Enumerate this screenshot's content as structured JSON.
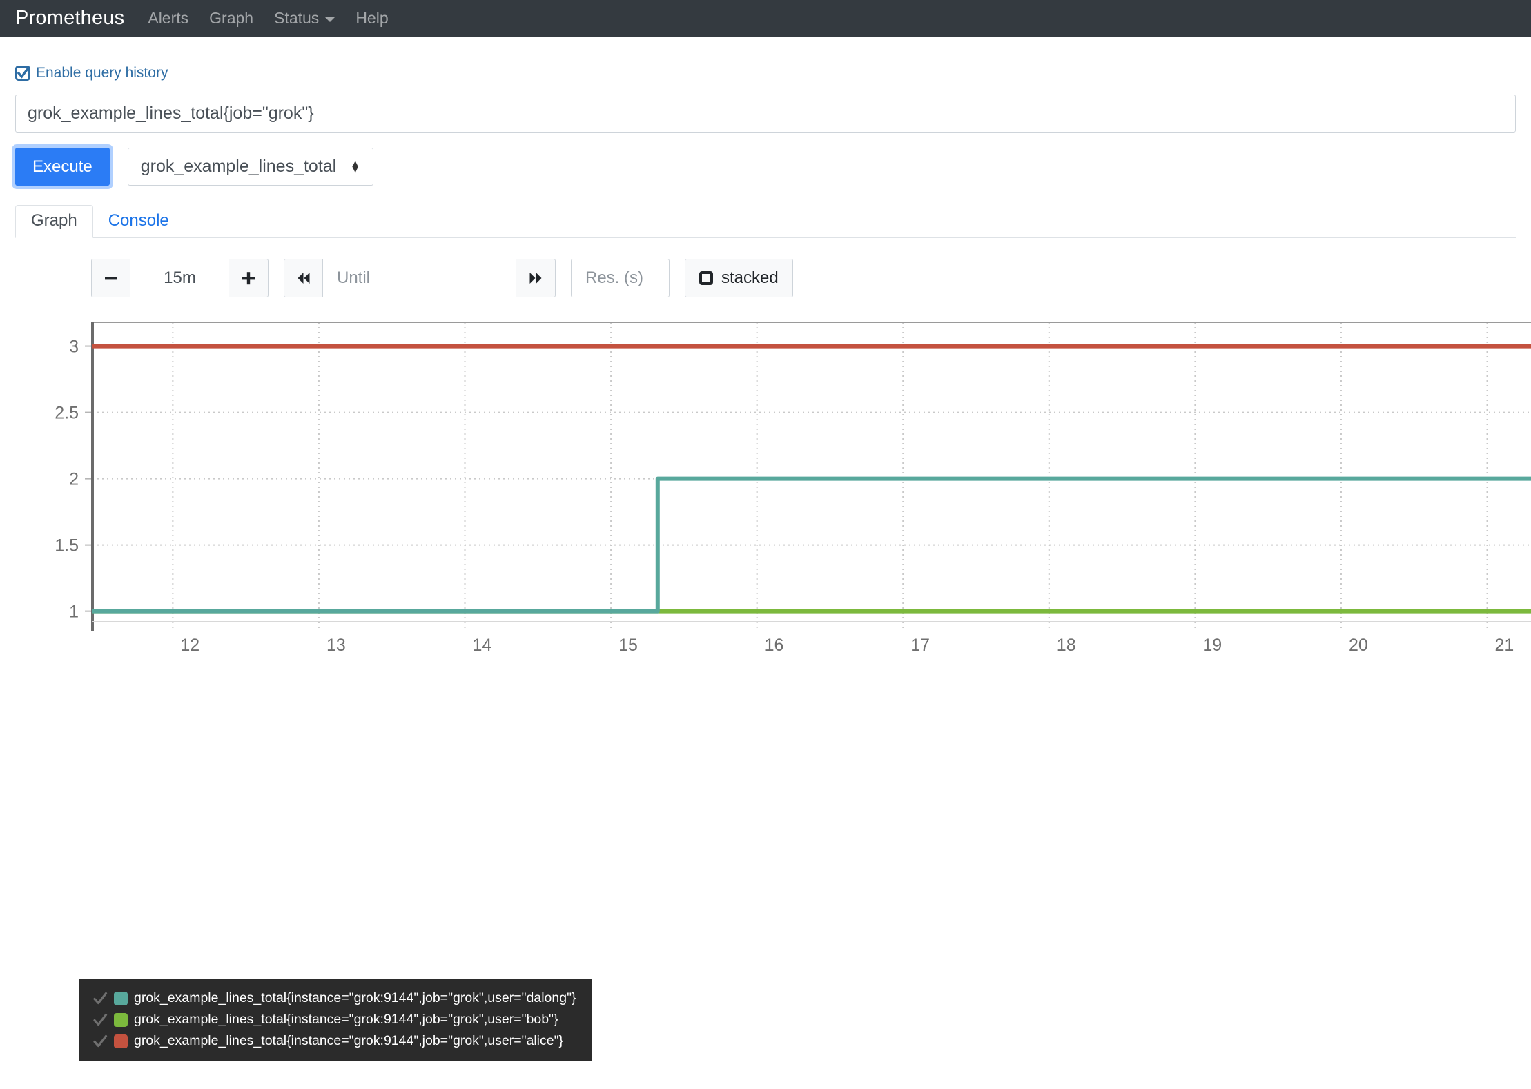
{
  "navbar": {
    "brand": "Prometheus",
    "links": [
      {
        "label": "Alerts",
        "icon": null
      },
      {
        "label": "Graph",
        "icon": null
      },
      {
        "label": "Status",
        "icon": "chevron-down-icon"
      },
      {
        "label": "Help",
        "icon": null
      }
    ]
  },
  "query": {
    "history_label": "Enable query history",
    "history_checked": true,
    "expression": "grok_example_lines_total{job=\"grok\"}",
    "execute_label": "Execute",
    "metric_selected": "grok_example_lines_total"
  },
  "tabs": [
    {
      "label": "Graph",
      "active": true
    },
    {
      "label": "Console",
      "active": false
    }
  ],
  "graph_controls": {
    "decrease_label": "−",
    "increase_label": "+",
    "range": "15m",
    "backward_label": "◀◀",
    "forward_label": "▶▶",
    "until_placeholder": "Until",
    "until_value": "",
    "resolution_placeholder": "Res. (s)",
    "resolution_value": "",
    "stacked_label": "stacked",
    "stacked_checked": false
  },
  "colors": {
    "dalong": "#58a89c",
    "bob": "#7cb93d",
    "alice": "#c4523f",
    "navbar_bg": "#343a40",
    "execute_bg": "#2b7cf5",
    "legend_bg": "#2b2b2b"
  },
  "chart_data": {
    "type": "line",
    "title": "",
    "xlabel": "",
    "ylabel": "",
    "xlim": [
      11.45,
      21.3
    ],
    "ylim": [
      0.92,
      3.18
    ],
    "x_ticks": [
      12,
      13,
      14,
      15,
      16,
      17,
      18,
      19,
      20,
      21
    ],
    "y_ticks": [
      1,
      1.5,
      2,
      2.5,
      3
    ],
    "grid": true,
    "legend_position": "bottom-left",
    "step": true,
    "series": [
      {
        "name": "grok_example_lines_total{instance=\"grok:9144\",job=\"grok\",user=\"dalong\"}",
        "color": "#58a89c",
        "enabled": true,
        "x": [
          11.45,
          15.32,
          15.32,
          21.3
        ],
        "values": [
          1,
          1,
          2,
          2
        ]
      },
      {
        "name": "grok_example_lines_total{instance=\"grok:9144\",job=\"grok\",user=\"bob\"}",
        "color": "#7cb93d",
        "enabled": true,
        "x": [
          11.45,
          21.3
        ],
        "values": [
          1,
          1
        ]
      },
      {
        "name": "grok_example_lines_total{instance=\"grok:9144\",job=\"grok\",user=\"alice\"}",
        "color": "#c4523f",
        "enabled": true,
        "x": [
          11.45,
          21.3
        ],
        "values": [
          3,
          3
        ]
      }
    ]
  }
}
